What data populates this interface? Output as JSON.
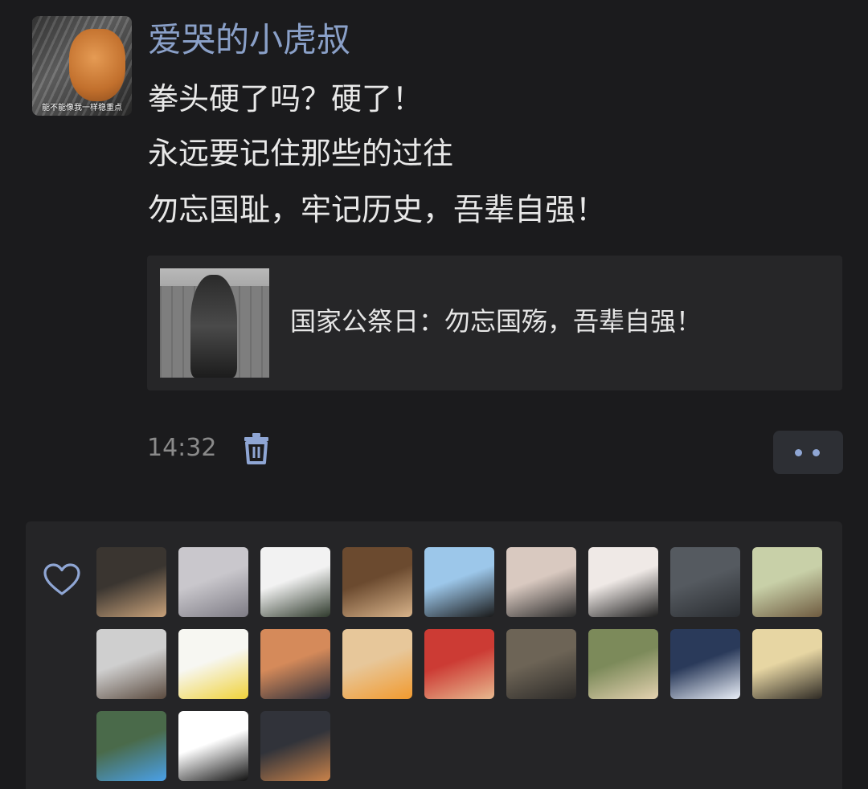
{
  "author": {
    "name": "爱哭的小虎叔",
    "avatar_caption": "能不能像我一样稳重点"
  },
  "post": {
    "lines": [
      "拳头硬了吗？硬了！",
      "永远要记住那些的过往",
      "勿忘国耻，牢记历史，吾辈自强！"
    ]
  },
  "link_card": {
    "title": "国家公祭日：勿忘国殇，吾辈自强！"
  },
  "meta": {
    "time": "14:32"
  },
  "icons": {
    "delete": "trash-icon",
    "more": "more-dots-icon",
    "like": "heart-icon"
  },
  "colors": {
    "username": "#8aa0c8",
    "accent_dots": "#8fa6d4"
  },
  "likers": [
    {
      "name": "liker-avatar-1",
      "palette": [
        "#3a3530",
        "#c9a27a"
      ]
    },
    {
      "name": "liker-avatar-2",
      "palette": [
        "#c9c7cc",
        "#7d7b84"
      ]
    },
    {
      "name": "liker-avatar-3",
      "palette": [
        "#f2f2f2",
        "#2f3a2c"
      ]
    },
    {
      "name": "liker-avatar-4",
      "palette": [
        "#6b4a2f",
        "#d8b38a"
      ]
    },
    {
      "name": "liker-avatar-5",
      "palette": [
        "#9cc7ea",
        "#1a1a1a"
      ]
    },
    {
      "name": "liker-avatar-6",
      "palette": [
        "#d9c9c0",
        "#2a2a2a"
      ]
    },
    {
      "name": "liker-avatar-7",
      "palette": [
        "#efe9e6",
        "#1e1e1e"
      ]
    },
    {
      "name": "liker-avatar-8",
      "palette": [
        "#555a60",
        "#2a2d31"
      ]
    },
    {
      "name": "liker-avatar-9",
      "palette": [
        "#c8d0a8",
        "#6e5a3f"
      ]
    },
    {
      "name": "liker-avatar-10",
      "palette": [
        "#cfcfcf",
        "#5a4a3e"
      ]
    },
    {
      "name": "liker-avatar-11",
      "palette": [
        "#f7f7f2",
        "#f0d23a"
      ]
    },
    {
      "name": "liker-avatar-12",
      "palette": [
        "#d58a5a",
        "#2a2d3a"
      ]
    },
    {
      "name": "liker-avatar-13",
      "palette": [
        "#e7c79a",
        "#f29a2e"
      ]
    },
    {
      "name": "liker-avatar-14",
      "palette": [
        "#cc3b34",
        "#e8b98f"
      ]
    },
    {
      "name": "liker-avatar-15",
      "palette": [
        "#6d6456",
        "#2c2a28"
      ]
    },
    {
      "name": "liker-avatar-16",
      "palette": [
        "#7c8a5a",
        "#e4d2b0"
      ]
    },
    {
      "name": "liker-avatar-17",
      "palette": [
        "#2a3a5a",
        "#eaeff8"
      ]
    },
    {
      "name": "liker-avatar-18",
      "palette": [
        "#e7d6a3",
        "#2e2a24"
      ]
    },
    {
      "name": "liker-avatar-19",
      "palette": [
        "#4a6a4a",
        "#4aa0e8"
      ]
    },
    {
      "name": "liker-avatar-20",
      "palette": [
        "#ffffff",
        "#111111"
      ]
    },
    {
      "name": "liker-avatar-21",
      "palette": [
        "#31333a",
        "#c9824a"
      ]
    }
  ]
}
